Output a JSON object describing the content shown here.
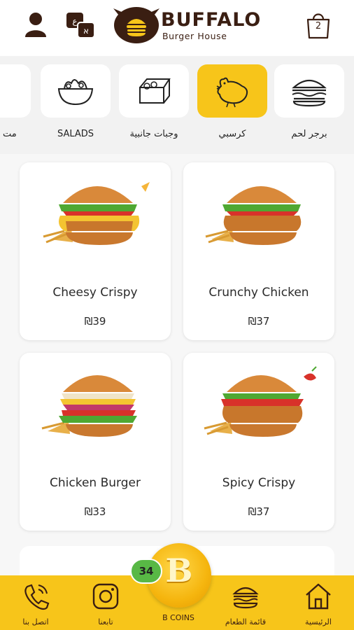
{
  "header": {
    "logo_title": "BUFFALO",
    "logo_subtitle": "Burger House",
    "cart_count": "2",
    "icons": [
      "user-icon",
      "language-icon",
      "cart-icon"
    ]
  },
  "categories": [
    {
      "label": "برجر لحم",
      "icon": "beef-burger-icon",
      "active": false
    },
    {
      "label": "كرسبي",
      "icon": "chicken-icon",
      "active": true
    },
    {
      "label": "وجبات جانبية",
      "icon": "side-meals-icon",
      "active": false
    },
    {
      "label": "SALADS",
      "icon": "salad-bowl-icon",
      "active": false
    },
    {
      "label": "مت",
      "icon": "",
      "active": false
    }
  ],
  "products": [
    {
      "name": "Cheesy Crispy",
      "price": "₪39"
    },
    {
      "name": "Crunchy Chicken",
      "price": "₪37"
    },
    {
      "name": "Chicken Burger",
      "price": "₪33"
    },
    {
      "name": "Spicy Crispy",
      "price": "₪37"
    }
  ],
  "bottom_nav": {
    "home": "الرئيسية",
    "menu": "قائمة الطعام",
    "coins_label": "B COINS",
    "coins_count": "34",
    "coin_letter": "B",
    "follow": "تابعنا",
    "contact": "اتصل بنا"
  },
  "colors": {
    "accent": "#f7c51a",
    "brand": "#3a1e12",
    "badge": "#58b845"
  }
}
